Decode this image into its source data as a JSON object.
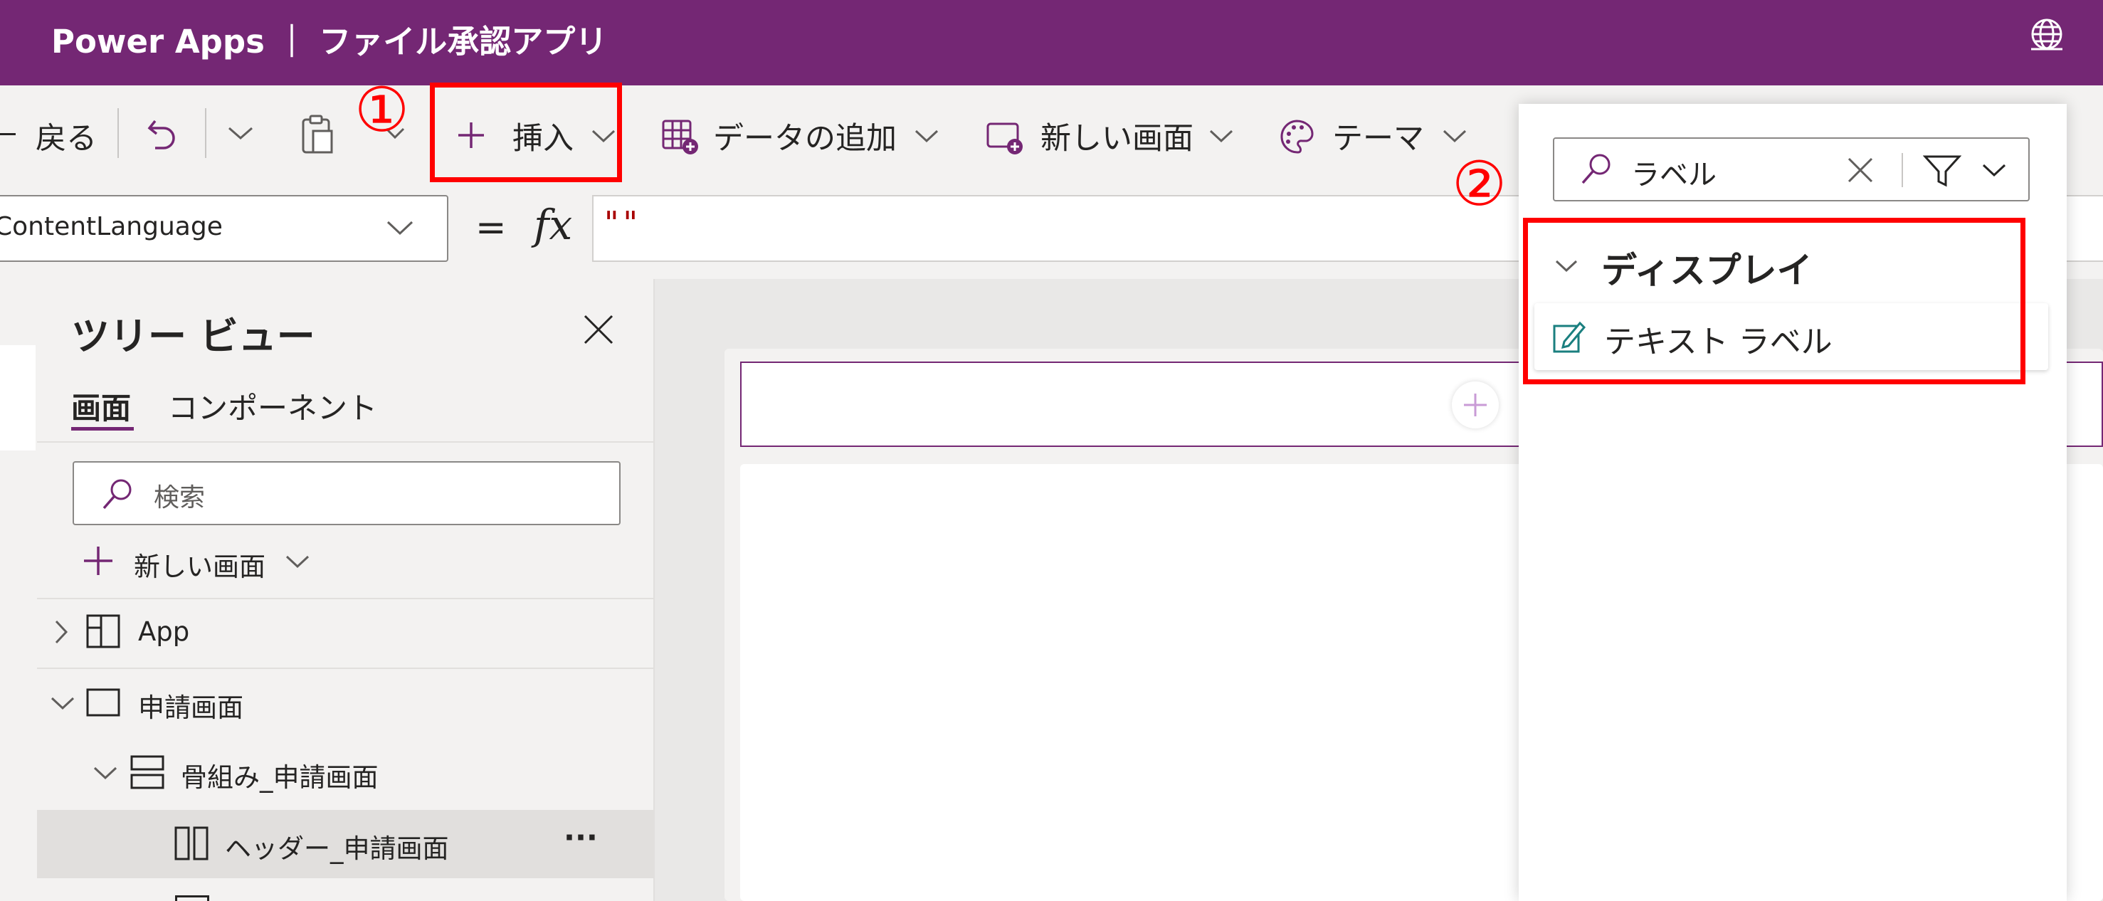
{
  "titlebar": {
    "title": "Power Apps ｜ ファイル承認アプリ",
    "bg_color": "#742774"
  },
  "toolbar": {
    "back_label": "戻る",
    "insert_label": "挿入",
    "add_data_label": "データの追加",
    "new_screen_label": "新しい画面",
    "theme_label": "テーマ"
  },
  "formula_bar": {
    "property": "ContentLanguage",
    "equals": "=",
    "fx": "fx",
    "value": "\"\""
  },
  "tree_view": {
    "title": "ツリー ビュー",
    "tabs": [
      "画面",
      "コンポーネント"
    ],
    "search_placeholder": "検索",
    "new_screen_label": "新しい画面",
    "items": [
      {
        "label": "App",
        "icon": "app-icon"
      },
      {
        "label": "申請画面",
        "icon": "screen-icon"
      },
      {
        "label": "骨組み_申請画面",
        "icon": "vertical-container-icon"
      },
      {
        "label": "ヘッダー_申請画面",
        "icon": "horizontal-container-icon",
        "more": "···"
      }
    ]
  },
  "insert_pane": {
    "search_value": "ラベル",
    "category": "ディスプレイ",
    "result_label": "テキスト ラベル"
  },
  "annotations": {
    "step1": "①",
    "step2": "②",
    "color": "#ff0000"
  },
  "colors": {
    "accent": "#742774",
    "annotation": "#ff0000"
  }
}
